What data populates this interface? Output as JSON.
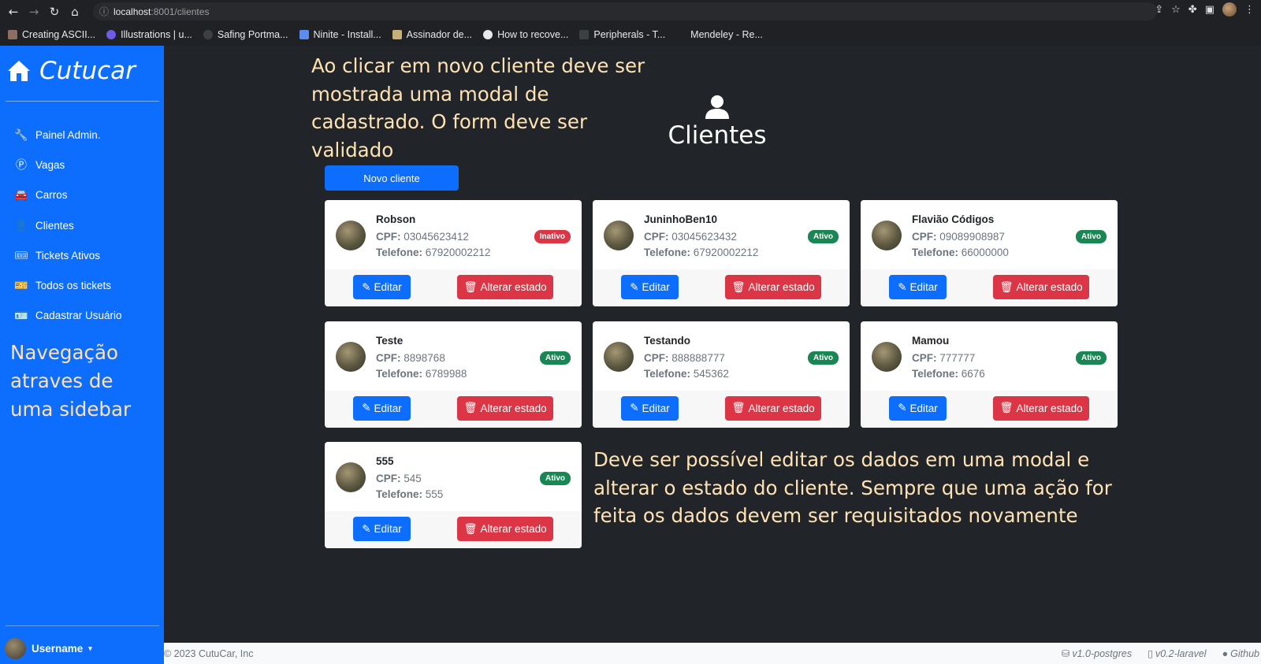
{
  "browser": {
    "url_host": "localhost",
    "url_rest": ":8001/clientes",
    "bookmarks": [
      "Creating ASCII...",
      "Illustrations | u...",
      "Safing Portma...",
      "Ninite - Install...",
      "Assinador de...",
      "How to recove...",
      "Peripherals - T...",
      "Mendeley - Re..."
    ]
  },
  "sidebar": {
    "brand": "Cutucar",
    "items": [
      {
        "label": "Painel Admin.",
        "icon": "wrench-icon"
      },
      {
        "label": "Vagas",
        "icon": "parking-icon"
      },
      {
        "label": "Carros",
        "icon": "car-icon"
      },
      {
        "label": "Clientes",
        "icon": "person-icon"
      },
      {
        "label": "Tickets Ativos",
        "icon": "ticket-icon"
      },
      {
        "label": "Todos os tickets",
        "icon": "tickets-icon"
      },
      {
        "label": "Cadastrar Usuário",
        "icon": "badge-icon"
      }
    ],
    "note": "Navegação atraves de uma sidebar",
    "username": "Username"
  },
  "main": {
    "note_top": "Ao clicar em novo cliente deve ser mostrada uma modal de cadastrado. O form deve ser validado",
    "title": "Clientes",
    "new_button": "Novo cliente",
    "note_bottom": "Deve ser possível editar os dados em uma modal e alterar o estado do cliente. Sempre que uma ação for feita os dados devem ser requisitados novamente",
    "cpf_label": "CPF:",
    "phone_label": "Telefone:",
    "edit_label": "Editar",
    "state_label": "Alterar estado",
    "clients": [
      {
        "name": "Robson",
        "cpf": "03045623412",
        "phone": "67920002212",
        "status": "Inativo"
      },
      {
        "name": "JuninhoBen10",
        "cpf": "03045623432",
        "phone": "67920002212",
        "status": "Ativo"
      },
      {
        "name": "Flavião Códigos",
        "cpf": "09089908987",
        "phone": "66000000",
        "status": "Ativo"
      },
      {
        "name": "Teste",
        "cpf": "8898768",
        "phone": "6789988",
        "status": "Ativo"
      },
      {
        "name": "Testando",
        "cpf": "888888777",
        "phone": "545362",
        "status": "Ativo"
      },
      {
        "name": "Mamou",
        "cpf": "777777",
        "phone": "6676",
        "status": "Ativo"
      },
      {
        "name": "555",
        "cpf": "545",
        "phone": "555",
        "status": "Ativo"
      }
    ]
  },
  "footer": {
    "copyright": "© 2023 CutuCar, Inc",
    "version_db": "v1.0-postgres",
    "version_app": "v0.2-laravel",
    "github": "Github"
  },
  "colors": {
    "primary": "#0d6efd",
    "danger": "#dc3545",
    "success": "#198754",
    "background": "#212529",
    "annotation": "#ffe2b3"
  }
}
